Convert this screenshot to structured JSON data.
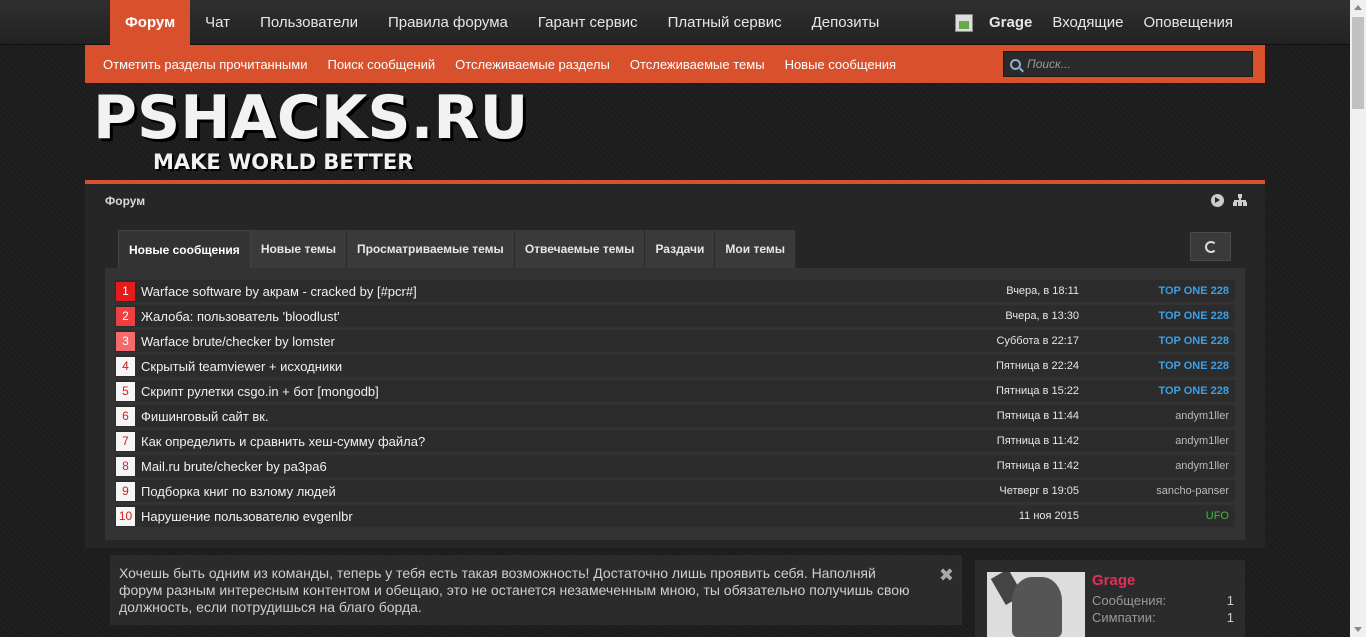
{
  "topnav": {
    "tabs": [
      {
        "label": "Форум",
        "active": true
      },
      {
        "label": "Чат"
      },
      {
        "label": "Пользователи"
      },
      {
        "label": "Правила форума"
      },
      {
        "label": "Гарант сервис"
      },
      {
        "label": "Платный сервис"
      },
      {
        "label": "Депозиты"
      }
    ],
    "username": "Grage",
    "inbox": "Входящие",
    "alerts": "Оповещения"
  },
  "subnav": {
    "links": [
      "Отметить разделы прочитанными",
      "Поиск сообщений",
      "Отслеживаемые разделы",
      "Отслеживаемые темы",
      "Новые сообщения"
    ],
    "search_placeholder": "Поиск..."
  },
  "logo": {
    "main": "PSHACKS.RU",
    "sub": "MAKE WORLD BETTER"
  },
  "breadcrumb": "Форум",
  "tabs": [
    "Новые сообщения",
    "Новые темы",
    "Просматриваемые темы",
    "Отвечаемые темы",
    "Раздачи",
    "Мои темы"
  ],
  "threads": [
    {
      "n": "1",
      "title": "Warface software by акрам - cracked by [#pcr#]",
      "date": "Вчера, в 18:11",
      "user": "TOP ONE 228",
      "ustyle": "blue",
      "bg": "#e31b1b",
      "fg": "#ffffff"
    },
    {
      "n": "2",
      "title": "Жалоба: пользователь 'bloodlust'",
      "date": "Вчера, в 13:30",
      "user": "TOP ONE 228",
      "ustyle": "blue",
      "bg": "#ee4040",
      "fg": "#ffffff"
    },
    {
      "n": "3",
      "title": "Warface brute/checker by lomster",
      "date": "Суббота в 22:17",
      "user": "TOP ONE 228",
      "ustyle": "blue",
      "bg": "#f56a6a",
      "fg": "#ffffff"
    },
    {
      "n": "4",
      "title": "Скрытый teamviewer + исходники",
      "date": "Пятница в 22:24",
      "user": "TOP ONE 228",
      "ustyle": "blue",
      "bg": "#f5f5f5",
      "fg": "#d02020"
    },
    {
      "n": "5",
      "title": "Скрипт рулетки csgo.in + бот [mongodb]",
      "date": "Пятница в 15:22",
      "user": "TOP ONE 228",
      "ustyle": "blue",
      "bg": "#f5f5f5",
      "fg": "#d02020"
    },
    {
      "n": "6",
      "title": "Фишинговый сайт вк.",
      "date": "Пятница в 11:44",
      "user": "andym1ller",
      "ustyle": "",
      "bg": "#f5f5f5",
      "fg": "#d02020"
    },
    {
      "n": "7",
      "title": "Как определить и сравнить хеш-сумму файла?",
      "date": "Пятница в 11:42",
      "user": "andym1ller",
      "ustyle": "",
      "bg": "#f5f5f5",
      "fg": "#d02020"
    },
    {
      "n": "8",
      "title": "Mail.ru brute/checker by pa3pa6",
      "date": "Пятница в 11:42",
      "user": "andym1ller",
      "ustyle": "",
      "bg": "#f5f5f5",
      "fg": "#d02020"
    },
    {
      "n": "9",
      "title": "Подборка книг по взлому людей",
      "date": "Четверг в 19:05",
      "user": "sancho-panser",
      "ustyle": "",
      "bg": "#f5f5f5",
      "fg": "#d02020"
    },
    {
      "n": "10",
      "title": "Нарушение пользователю evgenlbr",
      "date": "11 ноя 2015",
      "user": "UFO",
      "ustyle": "green",
      "bg": "#f5f5f5",
      "fg": "#d02020"
    }
  ],
  "notice": "Хочешь быть одним из команды, теперь у тебя есть такая возможность! Достаточно лишь проявить себя. Наполняй форум разным интересным контентом и обещаю, это не останется незамеченным мною, ты обязательно получишь свою должность, если потрудишься на благо борда.",
  "userbox": {
    "name": "Grage",
    "messages_label": "Сообщения:",
    "messages_value": "1",
    "likes_label": "Симпатии:",
    "likes_value": "1"
  },
  "colors": {
    "accent": "#d9512c",
    "username": "#e0305a",
    "top_user": "#3aa0e6",
    "ufo": "#3cb83c"
  }
}
